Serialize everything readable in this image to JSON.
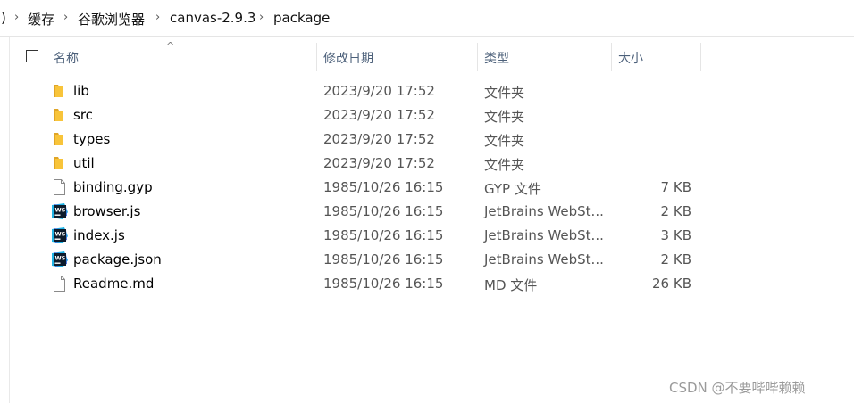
{
  "breadcrumb": {
    "lead": ")",
    "items": [
      "缓存",
      "谷歌浏览器",
      "canvas-2.9.3",
      "package"
    ]
  },
  "columns": {
    "name": "名称",
    "date": "修改日期",
    "type": "类型",
    "size": "大小"
  },
  "files": [
    {
      "name": "lib",
      "date": "2023/9/20 17:52",
      "type": "文件夹",
      "size": "",
      "icon": "folder-icon"
    },
    {
      "name": "src",
      "date": "2023/9/20 17:52",
      "type": "文件夹",
      "size": "",
      "icon": "folder-icon"
    },
    {
      "name": "types",
      "date": "2023/9/20 17:52",
      "type": "文件夹",
      "size": "",
      "icon": "folder-icon"
    },
    {
      "name": "util",
      "date": "2023/9/20 17:52",
      "type": "文件夹",
      "size": "",
      "icon": "folder-icon"
    },
    {
      "name": "binding.gyp",
      "date": "1985/10/26 16:15",
      "type": "GYP 文件",
      "size": "7 KB",
      "icon": "file-icon"
    },
    {
      "name": "browser.js",
      "date": "1985/10/26 16:15",
      "type": "JetBrains WebSt...",
      "size": "2 KB",
      "icon": "webstorm-icon"
    },
    {
      "name": "index.js",
      "date": "1985/10/26 16:15",
      "type": "JetBrains WebSt...",
      "size": "3 KB",
      "icon": "webstorm-icon"
    },
    {
      "name": "package.json",
      "date": "1985/10/26 16:15",
      "type": "JetBrains WebSt...",
      "size": "2 KB",
      "icon": "webstorm-icon"
    },
    {
      "name": "Readme.md",
      "date": "1985/10/26 16:15",
      "type": "MD 文件",
      "size": "26 KB",
      "icon": "file-icon"
    }
  ],
  "watermark": "CSDN @不要哔哔赖赖",
  "colors": {
    "folder": "#f8c43a",
    "header_text": "#4c607a",
    "webstorm_bg": "#0c1b2c",
    "webstorm_accent": "#21d789"
  }
}
